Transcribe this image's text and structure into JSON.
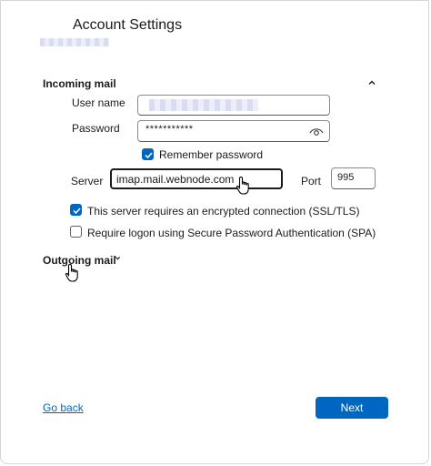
{
  "header": {
    "title": "Account Settings"
  },
  "incoming": {
    "heading": "Incoming mail",
    "username_label": "User name",
    "password_label": "Password",
    "password_value": "***********",
    "remember_label": "Remember password",
    "remember_checked": true,
    "server_label": "Server",
    "server_value": "imap.mail.webnode.com",
    "port_label": "Port",
    "port_value": "995",
    "ssl_label": "This server requires an encrypted connection (SSL/TLS)",
    "ssl_checked": true,
    "spa_label": "Require logon using Secure Password Authentication (SPA)",
    "spa_checked": false
  },
  "outgoing": {
    "heading": "Outgoing mail"
  },
  "footer": {
    "back_label": "Go back",
    "next_label": "Next"
  },
  "colors": {
    "accent": "#0067c0",
    "text": "#1b1b1b",
    "border": "#8a8a8a"
  },
  "icons": [
    "chevron-up-icon",
    "chevron-down-icon",
    "eye-icon",
    "checkmark-icon",
    "hand-cursor-icon"
  ]
}
